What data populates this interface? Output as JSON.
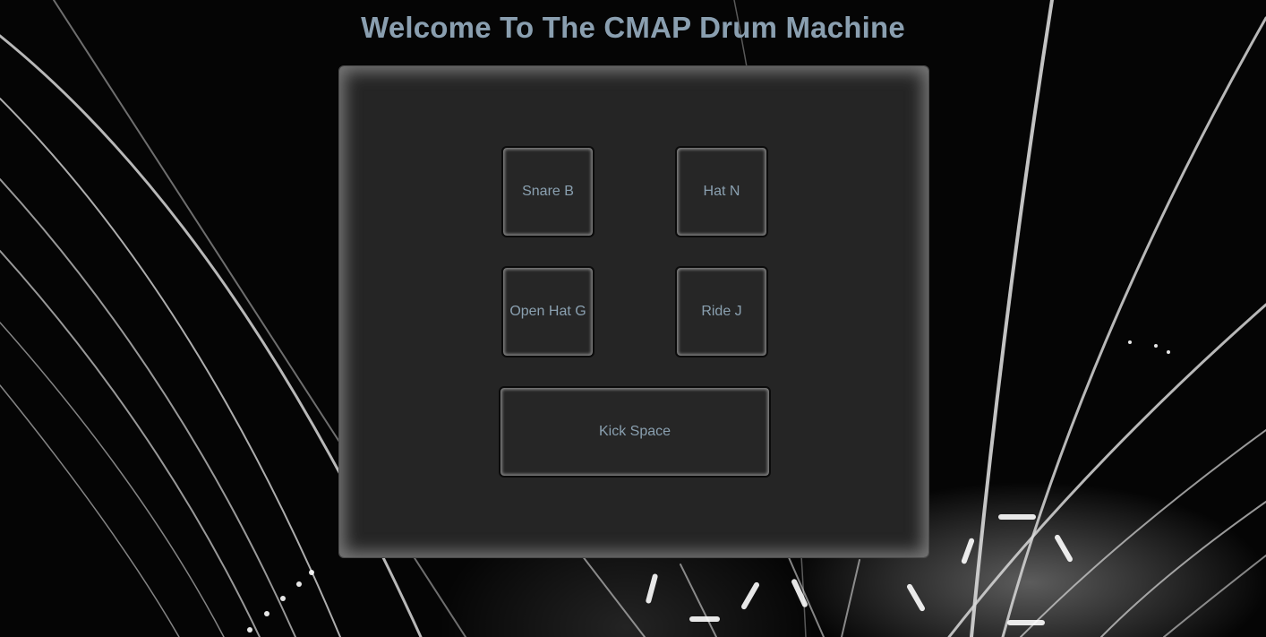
{
  "page": {
    "title": "Welcome To The CMAP Drum Machine"
  },
  "drum_pads": [
    {
      "label": "Snare B"
    },
    {
      "label": "Hat N"
    },
    {
      "label": "Open Hat G"
    },
    {
      "label": "Ride J"
    },
    {
      "label": "Kick Space"
    }
  ],
  "colors": {
    "title_text": "#8a9fb0",
    "pad_text": "#8aa0b0",
    "panel_background": "#252525",
    "page_background": "#000000"
  }
}
